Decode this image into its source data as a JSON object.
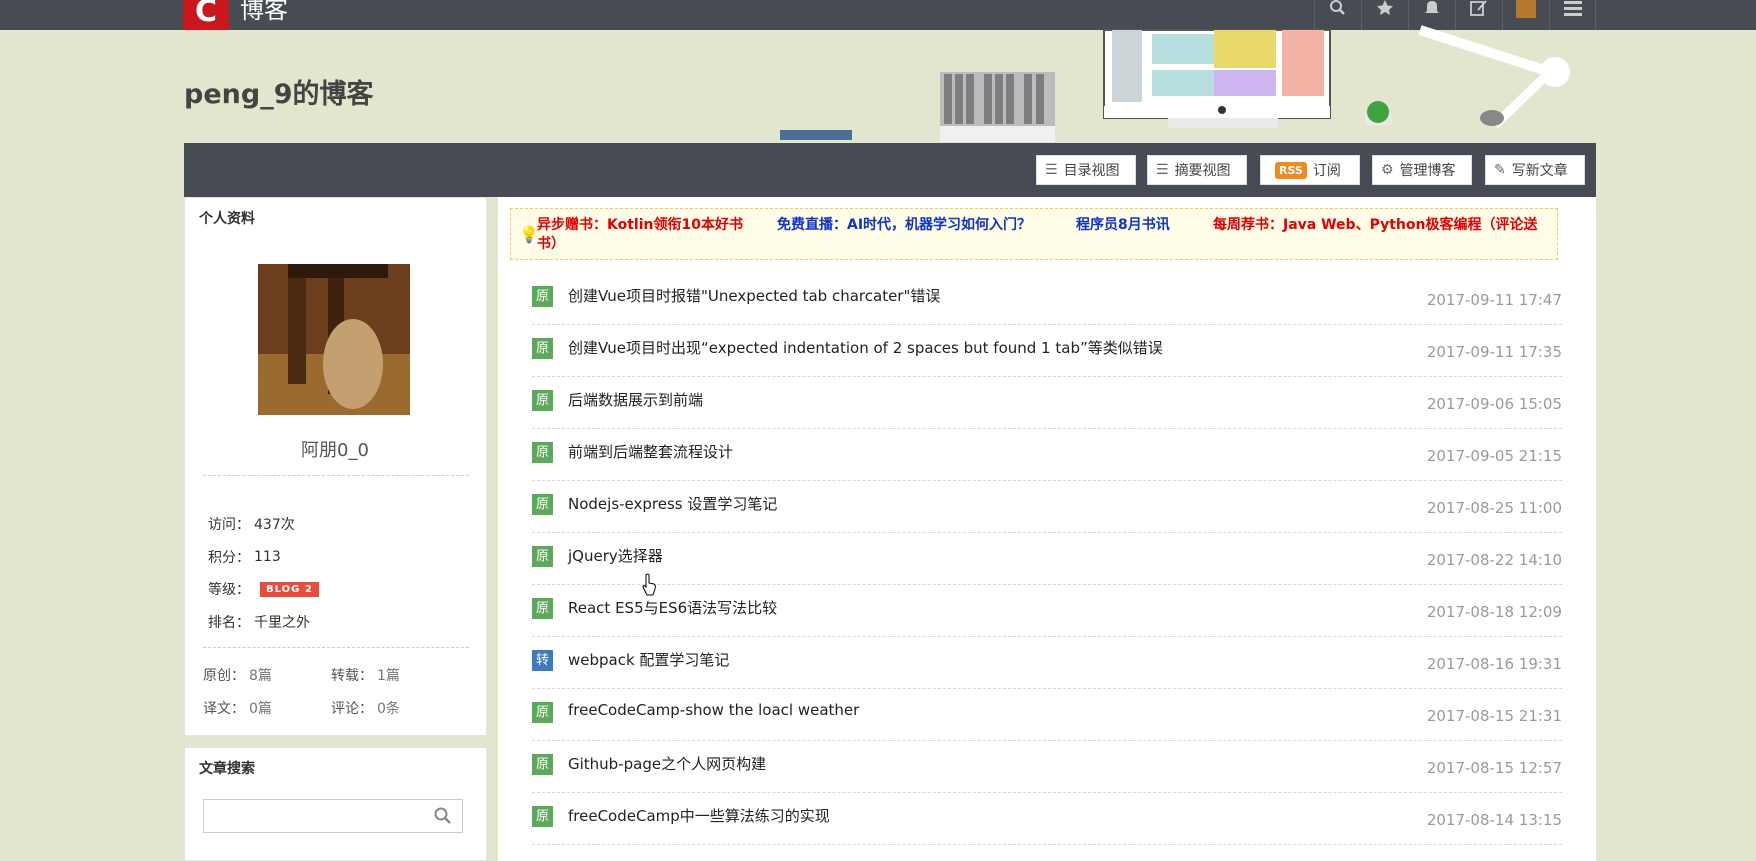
{
  "topbar": {
    "logo_letter": "C",
    "brand": "博客",
    "icons": [
      "search-icon",
      "star-icon",
      "bell-icon",
      "edit-icon",
      "user-avatar",
      "menu-icon"
    ]
  },
  "header": {
    "blog_title": "peng_9的博客"
  },
  "toolbar": {
    "catalog_view": "目录视图",
    "summary_view": "摘要视图",
    "rss_badge": "RSS",
    "subscribe": "订阅",
    "manage_blog": "管理博客",
    "write_article": "写新文章"
  },
  "profile": {
    "title": "个人资料",
    "name": "阿朋0_0",
    "visits_label": "访问：",
    "visits_value": "437次",
    "points_label": "积分：",
    "points_value": "113",
    "level_label": "等级：",
    "level_badge": "BLOG 2",
    "rank_label": "排名：",
    "rank_value": "千里之外",
    "original_label": "原创：",
    "original_value": "8篇",
    "repost_label": "转载：",
    "repost_value": "1篇",
    "translate_label": "译文：",
    "translate_value": "0篇",
    "comment_label": "评论：",
    "comment_value": "0条"
  },
  "search": {
    "title": "文章搜索",
    "placeholder": ""
  },
  "notice": {
    "link1": "异步赠书：Kotlin领衔10本好书",
    "link2": "免费直播：AI时代，机器学习如何入门？",
    "link3": "程序员8月书讯",
    "link4a": "每周荐书：Java Web、Python极客编程（评论送",
    "link4b": "书）"
  },
  "articles": [
    {
      "badge": "原",
      "title": "创建Vue项目时报错\"Unexpected tab charcater\"错误",
      "date": "2017-09-11 17:47"
    },
    {
      "badge": "原",
      "title": "创建Vue项目时出现“expected indentation of 2 spaces but found 1 tab”等类似错误",
      "date": "2017-09-11 17:35"
    },
    {
      "badge": "原",
      "title": "后端数据展示到前端",
      "date": "2017-09-06 15:05"
    },
    {
      "badge": "原",
      "title": "前端到后端整套流程设计",
      "date": "2017-09-05 21:15"
    },
    {
      "badge": "原",
      "title": "Nodejs-express 设置学习笔记",
      "date": "2017-08-25 11:00"
    },
    {
      "badge": "原",
      "title": "jQuery选择器",
      "date": "2017-08-22 14:10"
    },
    {
      "badge": "原",
      "title": "React ES5与ES6语法写法比较",
      "date": "2017-08-18 12:09"
    },
    {
      "badge": "转",
      "title": "webpack 配置学习笔记",
      "date": "2017-08-16 19:31"
    },
    {
      "badge": "原",
      "title": "freeCodeCamp-show the loacl weather",
      "date": "2017-08-15 21:31"
    },
    {
      "badge": "原",
      "title": "Github-page之个人网页构建",
      "date": "2017-08-15 12:57"
    },
    {
      "badge": "原",
      "title": "freeCodeCamp中一些算法练习的实现",
      "date": "2017-08-14 13:15"
    }
  ],
  "colors": {
    "topbar": "#474b54",
    "background": "#e3e6cf",
    "original_badge": "#5ca95c",
    "repost_badge": "#3b7cbd",
    "logo": "#c9171e"
  }
}
